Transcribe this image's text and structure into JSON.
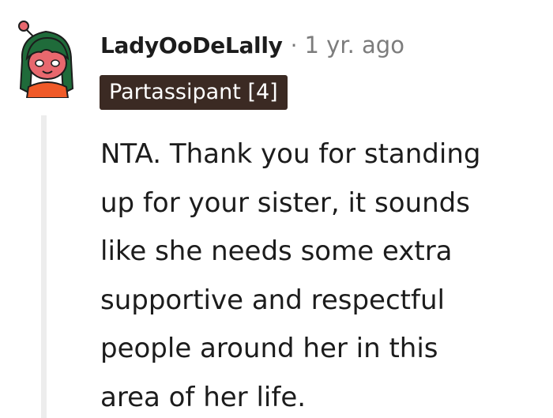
{
  "comment": {
    "author": "LadyOoDeLally",
    "separator": "·",
    "timestamp": "1 yr. ago",
    "flair": "Partassipant [4]",
    "body_lines": [
      "NTA. Thank you for standing",
      "up for your sister, it sounds",
      "like she needs some extra",
      "supportive and respectful",
      "people around her in this",
      "area of her life."
    ]
  },
  "colors": {
    "flair_background": "#3b2a23",
    "meta_text": "#7c7c7c",
    "thread_line": "#ededed",
    "avatar_skin": "#e8686e",
    "avatar_hair": "#1f6b3a",
    "avatar_dress": "#f05a28"
  }
}
